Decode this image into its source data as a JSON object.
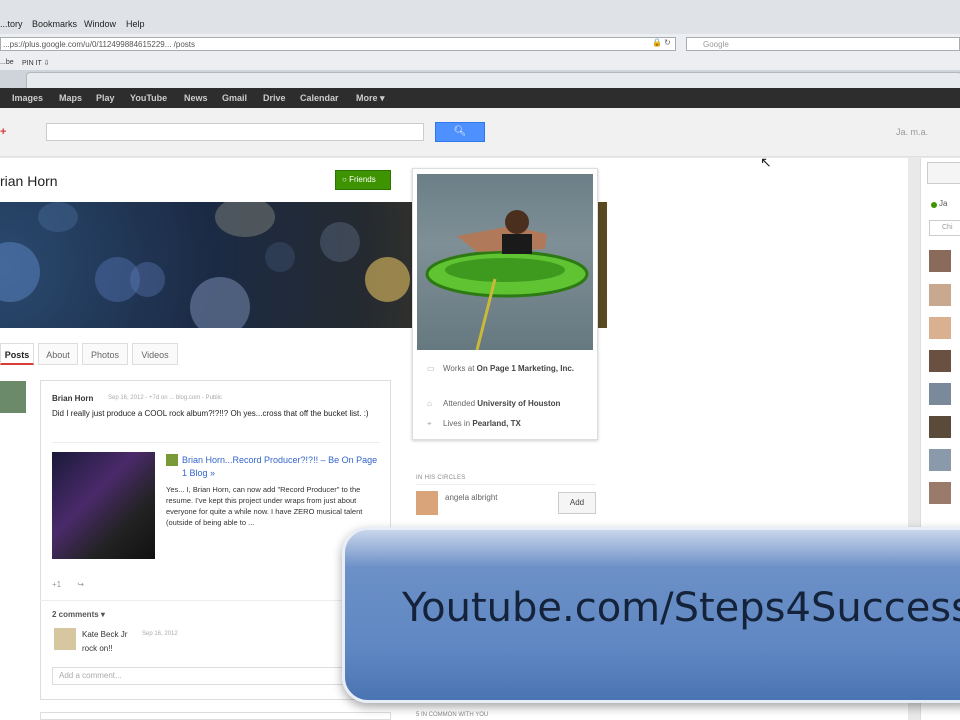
{
  "browser": {
    "menu": [
      "...tory",
      "Bookmarks",
      "Window",
      "Help"
    ],
    "url": "...ps://plus.google.com/u/0/112499884615229... /posts",
    "search_placeholder": "Google",
    "bookmarks": [
      "...be",
      "PIN IT ⇩"
    ]
  },
  "google_bar": {
    "items": [
      "Images",
      "Maps",
      "Play",
      "YouTube",
      "News",
      "Gmail",
      "Drive",
      "Calendar",
      "More ▾"
    ]
  },
  "header": {
    "logo": "+",
    "user": "Ja. m.a."
  },
  "profile": {
    "name": "rian Horn",
    "friends_button": "Friends",
    "tabs": [
      "Posts",
      "About",
      "Photos",
      "Videos"
    ]
  },
  "post": {
    "author": "Brian Horn",
    "meta": "Sep 16, 2012 - +7d on ... blog.com - Public",
    "text": "Did I really just produce a COOL rock album?!?!!? Oh yes...cross that off the bucket list. :)",
    "link_title": "Brian Horn...Record Producer?!?!! – Be On Page 1 Blog »",
    "link_body": "Yes... I, Brian Horn, can now add \"Record Producer\" to the resume. I've kept this project under wraps from just about everyone for quite a while now. I have ZERO musical talent (outside of being able to ...",
    "actions": [
      "+1",
      "↪"
    ],
    "comments_count": "2 comments ▾",
    "comment_author": "Kate Beck Jr",
    "comment_date": "Sep 16, 2012",
    "comment_text": "rock on!!",
    "add_comment_placeholder": "Add a comment..."
  },
  "about": {
    "works": "Works at",
    "works_org": "On Page 1 Marketing, Inc.",
    "attended": "Attended",
    "attended_school": "University of Houston",
    "lives": "Lives in",
    "lives_place": "Pearland, TX",
    "circles_label": "IN HIS CIRCLES",
    "circle_member": "angela albright",
    "add_button": "Add",
    "common_label": "5 IN COMMON WITH YOU"
  },
  "chat": {
    "status": "Ja",
    "search": "Chi"
  },
  "overlay": {
    "text": "Youtube.com/Steps4Success"
  }
}
